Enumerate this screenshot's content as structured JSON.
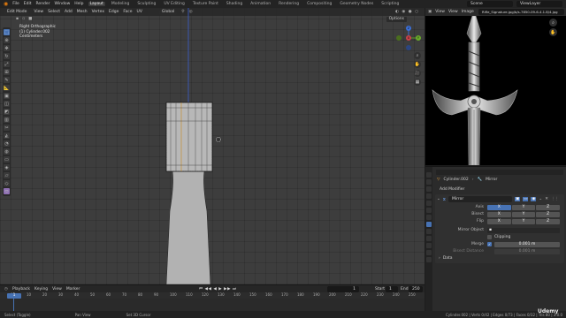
{
  "menubar": {
    "menus": [
      "File",
      "Edit",
      "Render",
      "Window",
      "Help"
    ],
    "workspaces": [
      "Layout",
      "Modeling",
      "Sculpting",
      "UV Editing",
      "Texture Paint",
      "Shading",
      "Animation",
      "Rendering",
      "Compositing",
      "Geometry Nodes",
      "Scripting"
    ],
    "active_workspace": "Layout",
    "scene": "Scene",
    "view_layer": "ViewLayer"
  },
  "viewport": {
    "mode": "Edit Mode",
    "menus": [
      "View",
      "Select",
      "Add",
      "Mesh",
      "Vertex",
      "Edge",
      "Face",
      "UV"
    ],
    "transform_orientation": "Global",
    "options_label": "Options",
    "overlay_lines": [
      "Right Orthographic",
      "(1) Cylinder.002",
      "Centimeters"
    ],
    "gizmo": {
      "x": "X",
      "y": "Y",
      "z": "Z"
    }
  },
  "image_editor": {
    "menus": [
      "View",
      "View",
      "Image"
    ],
    "filename": "Rifle_Signature.jpg/b/s-7850-09-6-4.1.8/4.jpg"
  },
  "properties": {
    "breadcrumb_object": "Cylinder.002",
    "breadcrumb_modifier": "Mirror",
    "add_modifier": "Add Modifier",
    "modifier_name": "Mirror",
    "axis_label": "Axis",
    "bisect_label": "Bisect",
    "flip_label": "Flip",
    "axes": [
      "X",
      "Y",
      "Z"
    ],
    "axis_on": [
      true,
      false,
      false
    ],
    "mirror_object_label": "Mirror Object",
    "clipping_label": "Clipping",
    "merge_label": "Merge",
    "merge_value": "0.001 m",
    "bisect_distance_label": "Bisect Distance",
    "bisect_distance_value": "0.001 m",
    "data_label": "Data"
  },
  "timeline": {
    "menus": [
      "Playback",
      "Keying",
      "View",
      "Marker"
    ],
    "current_frame": "1",
    "start_label": "Start",
    "start_value": "1",
    "end_label": "End",
    "end_value": "250",
    "ticks": [
      "0",
      "10",
      "20",
      "30",
      "40",
      "50",
      "60",
      "70",
      "80",
      "90",
      "100",
      "110",
      "120",
      "130",
      "140",
      "150",
      "160",
      "170",
      "180",
      "190",
      "200",
      "210",
      "220",
      "230",
      "240",
      "250"
    ]
  },
  "status": {
    "items": [
      "Select (Toggle)",
      "Pan View",
      "Set 3D Cursor"
    ],
    "right": "Cylinder.002 | Verts 0/42 | Edges 0/73 | Faces 0/32 | Tris 80 | 3.0.0"
  },
  "watermark": "Udemy",
  "colors": {
    "accent": "#4772b3",
    "viewport_bg": "#3d3d3d",
    "mesh": "#b9b9b9"
  }
}
